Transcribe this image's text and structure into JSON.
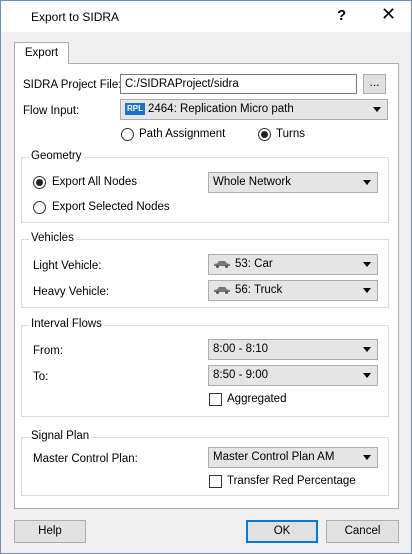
{
  "window": {
    "title": "Export to SIDRA",
    "help": "?",
    "close": "✕"
  },
  "tabs": [
    {
      "label": "Export"
    }
  ],
  "project": {
    "label": "SIDRA Project File:",
    "value": "C:/SIDRAProject/sidra",
    "browse": "..."
  },
  "flow": {
    "label": "Flow Input:",
    "badge": "RPL",
    "value": "2464: Replication Micro path",
    "options": [
      {
        "label": "Path Assignment",
        "selected": false
      },
      {
        "label": "Turns",
        "selected": true
      }
    ]
  },
  "geometry": {
    "title": "Geometry",
    "export_all": "Export All Nodes",
    "export_selected": "Export Selected Nodes",
    "selected_option": "all",
    "network_value": "Whole Network"
  },
  "vehicles": {
    "title": "Vehicles",
    "light_label": "Light Vehicle:",
    "light_value": "53: Car",
    "heavy_label": "Heavy Vehicle:",
    "heavy_value": "56: Truck"
  },
  "interval": {
    "title": "Interval Flows",
    "from_label": "From:",
    "from_value": "8:00 - 8:10",
    "to_label": "To:",
    "to_value": "8:50 - 9:00",
    "aggregated_label": "Aggregated",
    "aggregated": false
  },
  "signal": {
    "title": "Signal Plan",
    "master_label": "Master Control Plan:",
    "master_value": "Master Control Plan AM",
    "transfer_label": "Transfer Red Percentage",
    "transfer": false
  },
  "footer": {
    "help": "Help",
    "ok": "OK",
    "cancel": "Cancel"
  }
}
